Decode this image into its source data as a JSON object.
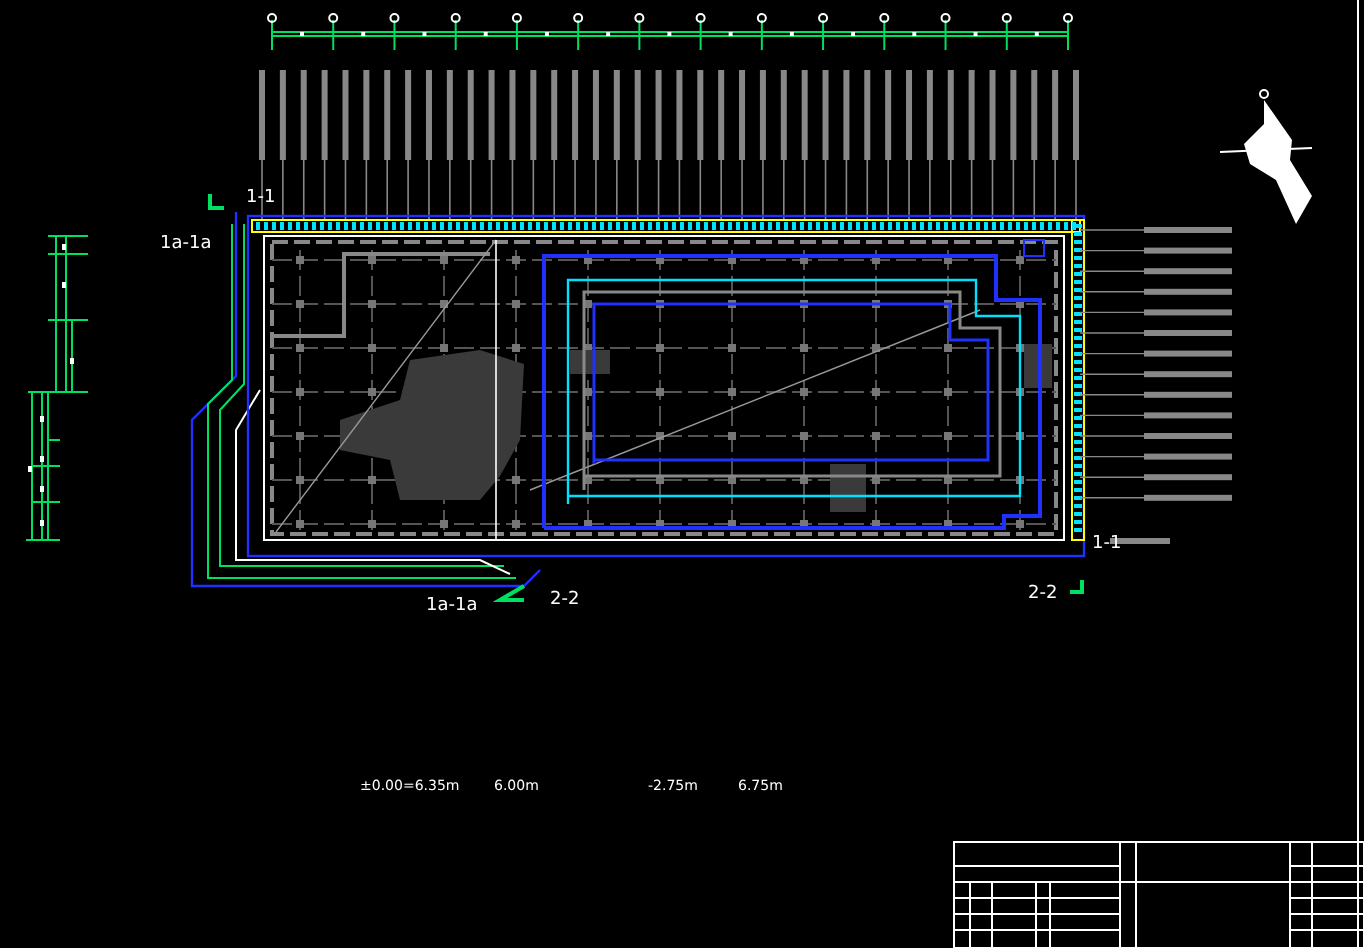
{
  "section_labels": [
    {
      "text": "1-1"
    },
    {
      "text": "1a-1a"
    },
    {
      "text": "1a-1a"
    },
    {
      "text": "2-2"
    },
    {
      "text": "2-2"
    },
    {
      "text": "1-1"
    }
  ],
  "notes": [
    {
      "text": "±0.00=6.35m"
    },
    {
      "text": "6.00m"
    },
    {
      "text": "-2.75m"
    },
    {
      "text": "6.75m"
    }
  ]
}
